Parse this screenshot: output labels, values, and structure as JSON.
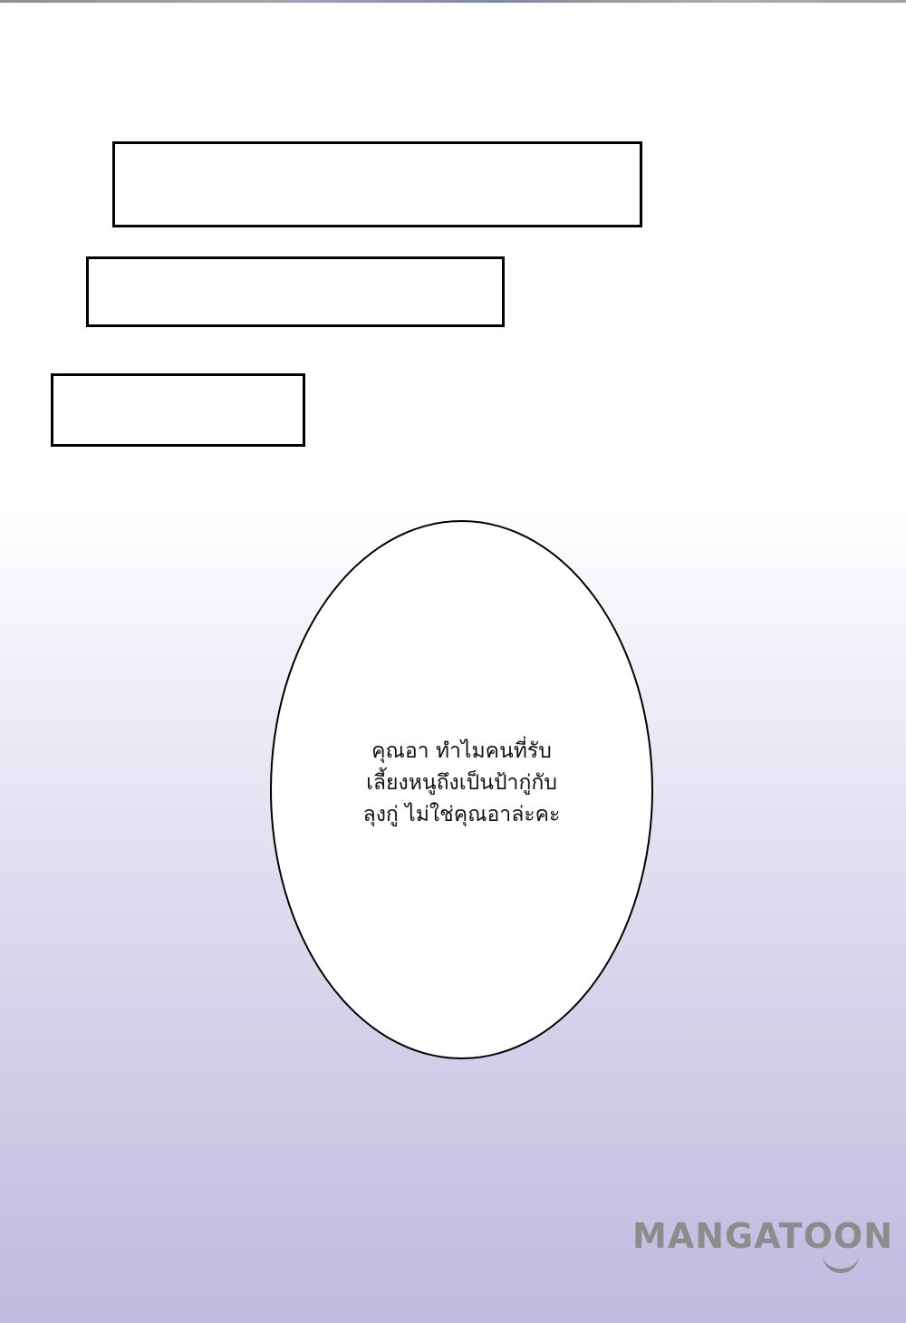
{
  "speech_bubble": {
    "lines": [
      "คุณอา ทำไมคนที่รับ",
      "เลี้ยงหนูถึงเป็นป้ากู่กับ",
      "ลุงกู่ ไม่ใช่คุณอาล่ะคะ"
    ]
  },
  "watermark": {
    "text": "MANGATOON"
  },
  "colors": {
    "background_top": "#ffffff",
    "background_bottom": "#c2b9e0",
    "border": "#000000",
    "watermark": "#8c8c8c"
  }
}
